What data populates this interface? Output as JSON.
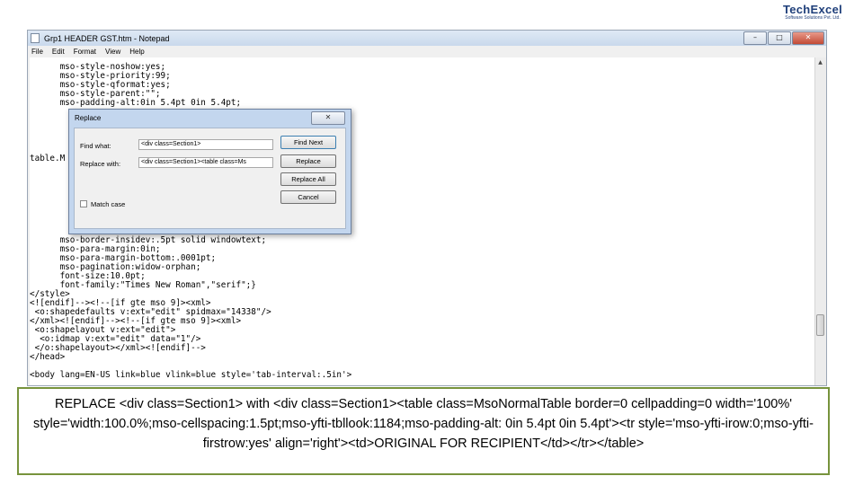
{
  "logo": {
    "name": "TechExcel",
    "tagline": "Software Solutions Pvt. Ltd."
  },
  "notepad": {
    "title": "Grp1 HEADER GST.htm - Notepad",
    "controls": {
      "minimize": "–",
      "maximize": "□",
      "close": "✕"
    },
    "menu": [
      "File",
      "Edit",
      "Format",
      "View",
      "Help"
    ],
    "lines": [
      {
        "text": "      mso-style-noshow:yes;"
      },
      {
        "text": "      mso-style-priority:99;"
      },
      {
        "text": "      mso-style-qformat:yes;"
      },
      {
        "text": "      mso-style-parent:\"\";"
      },
      {
        "text": "      mso-padding-alt:0in 5.4pt 0in 5.4pt;"
      },
      {
        "text": "table.M"
      },
      {
        "text": "      mso-border-insidev:.5pt solid windowtext;"
      },
      {
        "text": "      mso-para-margin:0in;"
      },
      {
        "text": "      mso-para-margin-bottom:.0001pt;"
      },
      {
        "text": "      mso-pagination:widow-orphan;"
      },
      {
        "text": "      font-size:10.0pt;"
      },
      {
        "text": "      font-family:\"Times New Roman\",\"serif\";}"
      },
      {
        "text": "</style>"
      },
      {
        "text": "<![endif]--><!--[if gte mso 9]><xml>"
      },
      {
        "text": " <o:shapedefaults v:ext=\"edit\" spidmax=\"14338\"/>"
      },
      {
        "text": "</xml><![endif]--><!--[if gte mso 9]><xml>"
      },
      {
        "text": " <o:shapelayout v:ext=\"edit\">"
      },
      {
        "text": "  <o:idmap v:ext=\"edit\" data=\"1\"/>"
      },
      {
        "text": " </o:shapelayout></xml><![endif]-->"
      },
      {
        "text": "</head>"
      },
      {
        "text": "<body lang=EN-US link=blue vlink=blue style='tab-interval:.5in'>"
      }
    ]
  },
  "replace_dialog": {
    "title": "Replace",
    "close": "✕",
    "find_label": "Find what:",
    "find_value": "<div class=Section1>",
    "replace_label": "Replace with:",
    "replace_value": "<div class=Section1><table class=Ms",
    "find_next": "Find Next",
    "replace": "Replace",
    "replace_all": "Replace All",
    "cancel": "Cancel",
    "match_case": "Match case"
  },
  "caption": {
    "text": "REPLACE <div class=Section1> with <div class=Section1><table class=MsoNormalTable border=0 cellpadding=0 width='100%' style='width:100.0%;mso-cellspacing:1.5pt;mso-yfti-tbllook:1184;mso-padding-alt: 0in 5.4pt 0in 5.4pt'><tr style='mso-yfti-irow:0;mso-yfti-firstrow:yes' align='right'><td>ORIGINAL FOR RECIPIENT</td></tr></table>"
  }
}
